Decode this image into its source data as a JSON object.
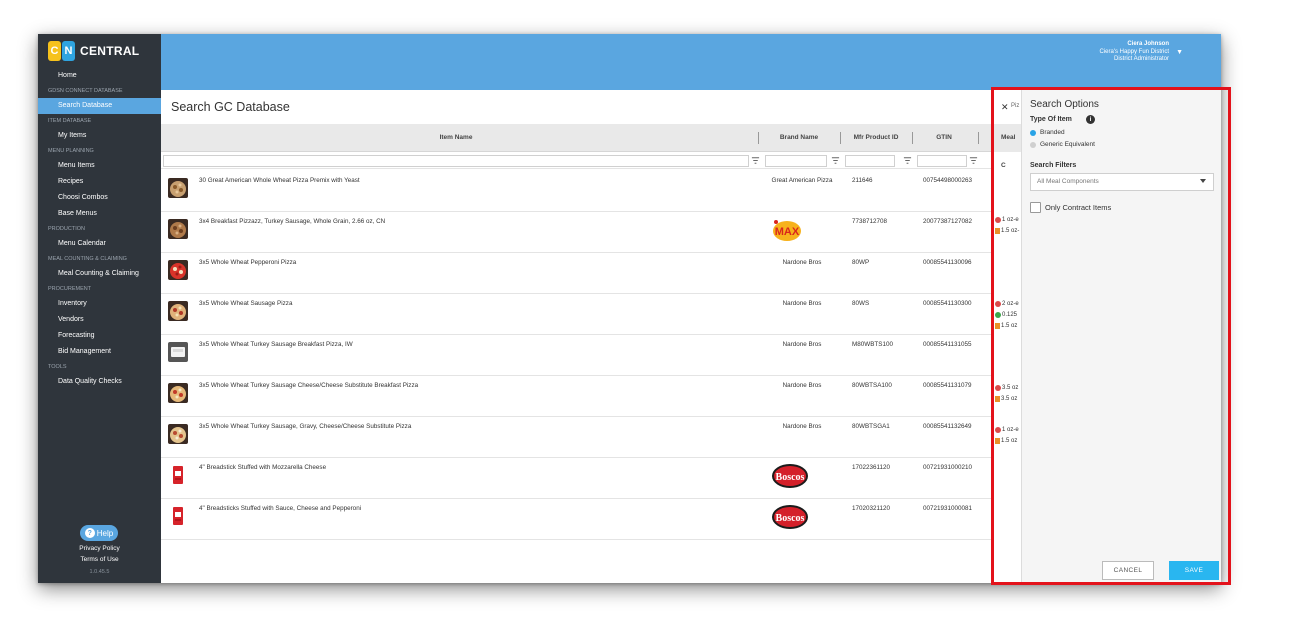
{
  "app": {
    "logo_c": "C",
    "logo_n": "N",
    "logo_text": "CENTRAL"
  },
  "sidebar": {
    "home": "Home",
    "sections": [
      {
        "title": "GDSN CONNECT DATABASE",
        "items": [
          "Search Database"
        ]
      },
      {
        "title": "ITEM DATABASE",
        "items": [
          "My Items"
        ]
      },
      {
        "title": "MENU PLANNING",
        "items": [
          "Menu Items",
          "Recipes",
          "Choosi Combos",
          "Base Menus"
        ]
      },
      {
        "title": "PRODUCTION",
        "items": [
          "Menu Calendar"
        ]
      },
      {
        "title": "MEAL COUNTING & CLAIMING",
        "items": [
          "Meal Counting & Claiming"
        ]
      },
      {
        "title": "PROCUREMENT",
        "items": [
          "Inventory",
          "Vendors",
          "Forecasting",
          "Bid Management"
        ]
      },
      {
        "title": "TOOLS",
        "items": [
          "Data Quality Checks"
        ]
      }
    ],
    "active_item": "Search Database",
    "help": "Help",
    "privacy": "Privacy Policy",
    "terms": "Terms of Use",
    "version": "1.0.45.5"
  },
  "header": {
    "user_name": "Ciera Johnson",
    "district": "Ciera's Happy Fun District",
    "role": "District Administrator"
  },
  "main": {
    "title": "Search GC Database",
    "columns": {
      "item_name": "Item Name",
      "brand_name": "Brand Name",
      "mfr_product_id": "Mfr Product ID",
      "gtin": "GTIN",
      "meal": "Meal C"
    },
    "rows": [
      {
        "name": "30 Great American Whole Wheat Pizza Premix with Yeast",
        "brand": "Great American Pizza",
        "mfr": "211646",
        "gtin": "00754498000263",
        "thumb": "pizza-premix",
        "meal": []
      },
      {
        "name": "3x4 Breakfast Pizzazz, Turkey Sausage, Whole Grain, 2.66 oz, CN",
        "brand": "",
        "brand_logo": "max-logo",
        "mfr": "7738712708",
        "gtin": "20077387127082",
        "thumb": "breakfast-pizza",
        "meal": [
          {
            "icon": "dot-red",
            "text": "1 oz-e"
          },
          {
            "icon": "sq-orange",
            "text": "1.5 oz-"
          }
        ]
      },
      {
        "name": "3x5 Whole Wheat Pepperoni Pizza",
        "brand": "Nardone Bros",
        "mfr": "80WP",
        "gtin": "00085541130096",
        "thumb": "pepperoni-pizza",
        "meal": []
      },
      {
        "name": "3x5 Whole Wheat Sausage Pizza",
        "brand": "Nardone Bros",
        "mfr": "80WS",
        "gtin": "00085541130300",
        "thumb": "sausage-pizza",
        "meal": [
          {
            "icon": "dot-red",
            "text": "2 oz-e"
          },
          {
            "icon": "dot-green",
            "text": "0.125"
          },
          {
            "icon": "sq-orange",
            "text": "1.5 oz"
          }
        ]
      },
      {
        "name": "3x5 Whole Wheat Turkey Sausage Breakfast Pizza, IW",
        "brand": "Nardone Bros",
        "mfr": "M80WBTS100",
        "gtin": "00085541131055",
        "thumb": "boxed-pizza",
        "meal": []
      },
      {
        "name": "3x5 Whole Wheat Turkey Sausage Cheese/Cheese Substitute Breakfast Pizza",
        "brand": "Nardone Bros",
        "mfr": "80WBTSA100",
        "gtin": "00085541131079",
        "thumb": "cheese-pizza",
        "meal": [
          {
            "icon": "dot-red",
            "text": "3.5 oz"
          },
          {
            "icon": "sq-orange",
            "text": "3.5 oz"
          }
        ]
      },
      {
        "name": "3x5 Whole Wheat Turkey Sausage, Gravy, Cheese/Cheese Substitute Pizza",
        "brand": "Nardone Bros",
        "mfr": "80WBTSGA1",
        "gtin": "00085541132649",
        "thumb": "gravy-pizza",
        "meal": [
          {
            "icon": "dot-red",
            "text": "1 oz-e"
          },
          {
            "icon": "sq-orange",
            "text": "1.5 oz"
          }
        ]
      },
      {
        "name": "4\" Breadstick Stuffed with Mozzarella Cheese",
        "brand": "",
        "brand_logo": "boscos-logo",
        "mfr": "17022361120",
        "gtin": "00721931000210",
        "thumb": "breadstick-box",
        "meal": []
      },
      {
        "name": "4\" Breadsticks Stuffed with Sauce, Cheese and Pepperoni",
        "brand": "",
        "brand_logo": "boscos-logo",
        "mfr": "17020321120",
        "gtin": "00721931000081",
        "thumb": "breadstick-box",
        "meal": []
      }
    ]
  },
  "search_chip": {
    "text": "Piz"
  },
  "options": {
    "title": "Search Options",
    "type_label": "Type Of Item",
    "type_options": [
      {
        "label": "Branded",
        "selected": true
      },
      {
        "label": "Generic Equivalent",
        "selected": false
      }
    ],
    "filters_label": "Search Filters",
    "meal_components_value": "All Meal Components",
    "contract_label": "Only Contract Items",
    "contract_checked": false,
    "cancel": "CANCEL",
    "save": "SAVE"
  },
  "colors": {
    "sidebar_bg": "#2f353c",
    "accent_blue": "#5aa6e0",
    "save_blue": "#29b6f0",
    "highlight_red": "#e3121b"
  }
}
